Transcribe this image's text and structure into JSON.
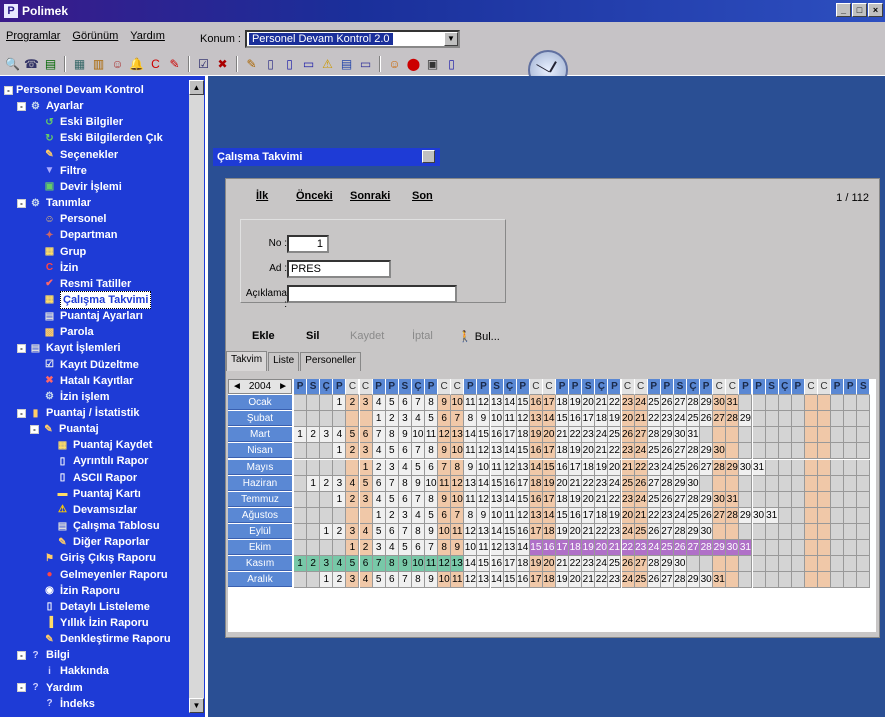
{
  "app": {
    "title": "Polimek",
    "logo": "P"
  },
  "menu": [
    "Programlar",
    "Görünüm",
    "Yardım"
  ],
  "konum": {
    "label": "Konum :",
    "value": "Personel Devam Kontrol 2.0"
  },
  "toolbar_icons": [
    "binoculars-icon",
    "phone-icon",
    "table-icon",
    "grid-icon",
    "chart-icon",
    "people-icon",
    "bell-icon",
    "c-icon",
    "edit-icon",
    "check-icon",
    "delete-icon",
    "pen-icon",
    "doc-icon",
    "page-icon",
    "page2-icon",
    "warning-icon",
    "list-icon",
    "monitor-icon",
    "users-icon",
    "stop-icon",
    "disk-icon",
    "file-icon"
  ],
  "sidebar": {
    "items": [
      {
        "label": "Personel Devam Kontrol",
        "indent": 0,
        "icon": "",
        "exp": "-"
      },
      {
        "label": "Ayarlar",
        "indent": 1,
        "icon": "⚙",
        "exp": "-"
      },
      {
        "label": "Eski Bilgiler",
        "indent": 3,
        "icon": "↺"
      },
      {
        "label": "Eski Bilgilerden Çık",
        "indent": 3,
        "icon": "↻"
      },
      {
        "label": "Seçenekler",
        "indent": 3,
        "icon": "✎"
      },
      {
        "label": "Filtre",
        "indent": 3,
        "icon": "▼"
      },
      {
        "label": "Devir İşlemi",
        "indent": 3,
        "icon": "▣"
      },
      {
        "label": "Tanımlar",
        "indent": 1,
        "icon": "⚙",
        "exp": "-"
      },
      {
        "label": "Personel",
        "indent": 3,
        "icon": "☺"
      },
      {
        "label": "Departman",
        "indent": 3,
        "icon": "✦"
      },
      {
        "label": "Grup",
        "indent": 3,
        "icon": "▦"
      },
      {
        "label": "İzin",
        "indent": 3,
        "icon": "C"
      },
      {
        "label": "Resmi Tatiller",
        "indent": 3,
        "icon": "✔"
      },
      {
        "label": "Çalışma Takvimi",
        "indent": 3,
        "icon": "▦",
        "selected": true
      },
      {
        "label": "Puantaj Ayarları",
        "indent": 3,
        "icon": "▤"
      },
      {
        "label": "Parola",
        "indent": 3,
        "icon": "▩"
      },
      {
        "label": "Kayıt İşlemleri",
        "indent": 1,
        "icon": "▤",
        "exp": "-"
      },
      {
        "label": "Kayıt Düzeltme",
        "indent": 3,
        "icon": "☑"
      },
      {
        "label": "Hatalı Kayıtlar",
        "indent": 3,
        "icon": "✖"
      },
      {
        "label": "İzin işlem",
        "indent": 3,
        "icon": "⚙"
      },
      {
        "label": "Puantaj / İstatistik",
        "indent": 1,
        "icon": "▮",
        "exp": "-"
      },
      {
        "label": "Puantaj",
        "indent": 2,
        "icon": "✎",
        "exp": "-"
      },
      {
        "label": "Puantaj Kaydet",
        "indent": 4,
        "icon": "▦"
      },
      {
        "label": "Ayrıntılı Rapor",
        "indent": 4,
        "icon": "▯"
      },
      {
        "label": "ASCII Rapor",
        "indent": 4,
        "icon": "▯"
      },
      {
        "label": "Puantaj Kartı",
        "indent": 4,
        "icon": "▬"
      },
      {
        "label": "Devamsızlar",
        "indent": 4,
        "icon": "⚠"
      },
      {
        "label": "Çalışma Tablosu",
        "indent": 4,
        "icon": "▤"
      },
      {
        "label": "Diğer Raporlar",
        "indent": 4,
        "icon": "✎"
      },
      {
        "label": "Giriş Çıkış Raporu",
        "indent": 3,
        "icon": "⚑"
      },
      {
        "label": "Gelmeyenler Raporu",
        "indent": 3,
        "icon": "●"
      },
      {
        "label": "İzin Raporu",
        "indent": 3,
        "icon": "◉"
      },
      {
        "label": "Detaylı Listeleme",
        "indent": 3,
        "icon": "▯"
      },
      {
        "label": "Yıllık İzin Raporu",
        "indent": 3,
        "icon": "▐"
      },
      {
        "label": "Denkleştirme Raporu",
        "indent": 3,
        "icon": "✎"
      },
      {
        "label": "Bilgi",
        "indent": 1,
        "icon": "?",
        "exp": "-"
      },
      {
        "label": "Hakkında",
        "indent": 3,
        "icon": "i"
      },
      {
        "label": "Yardım",
        "indent": 1,
        "icon": "?",
        "exp": "-"
      },
      {
        "label": "İndeks",
        "indent": 3,
        "icon": "?"
      }
    ]
  },
  "dialog": {
    "title": "Çalışma Takvimi",
    "nav": {
      "first": "İlk",
      "prev": "Önceki",
      "next": "Sonraki",
      "last": "Son"
    },
    "page": "1 / 112",
    "fields": {
      "no_label": "No :",
      "no_value": "1",
      "ad_label": "Ad :",
      "ad_value": "PRES",
      "aciklama_label": "Açıklama :",
      "aciklama_value": ""
    },
    "actions": {
      "add": "Ekle",
      "delete": "Sil",
      "save": "Kaydet",
      "cancel": "İptal",
      "find": "Bul..."
    },
    "tabs": [
      "Takvim",
      "Liste",
      "Personeller"
    ]
  },
  "calendar": {
    "year": "2004",
    "day_headers": [
      "P",
      "S",
      "Ç",
      "P",
      "C",
      "C",
      "P",
      "P",
      "S",
      "Ç",
      "P",
      "C",
      "C",
      "P",
      "P",
      "S",
      "Ç",
      "P",
      "C",
      "C",
      "P",
      "P",
      "S",
      "Ç",
      "P",
      "C",
      "C",
      "P",
      "P",
      "S",
      "Ç",
      "P",
      "C",
      "C",
      "P",
      "P",
      "S",
      "Ç",
      "P",
      "C",
      "C",
      "P",
      "P",
      "S"
    ],
    "months": [
      {
        "name": "Ocak",
        "offset": 3,
        "days": 31
      },
      {
        "name": "Şubat",
        "offset": 6,
        "days": 29
      },
      {
        "name": "Mart",
        "offset": 0,
        "days": 31
      },
      {
        "name": "Nisan",
        "offset": 3,
        "days": 30
      },
      {
        "name": "Mayıs",
        "offset": 5,
        "days": 31
      },
      {
        "name": "Haziran",
        "offset": 1,
        "days": 30
      },
      {
        "name": "Temmuz",
        "offset": 3,
        "days": 31
      },
      {
        "name": "Ağustos",
        "offset": 6,
        "days": 31
      },
      {
        "name": "Eylül",
        "offset": 2,
        "days": 30
      },
      {
        "name": "Ekim",
        "offset": 4,
        "days": 31
      },
      {
        "name": "Kasım",
        "offset": 0,
        "days": 30
      },
      {
        "name": "Aralık",
        "offset": 2,
        "days": 31
      }
    ],
    "highlights": {
      "ekim_purple_from": 15,
      "kasim_green_to": 13
    },
    "colors": {
      "weekday": "#f0f0f0",
      "weekend": "#f0c8a8",
      "header": "#5a88d4",
      "purple": "#b070c8",
      "green": "#78c8a8"
    }
  }
}
